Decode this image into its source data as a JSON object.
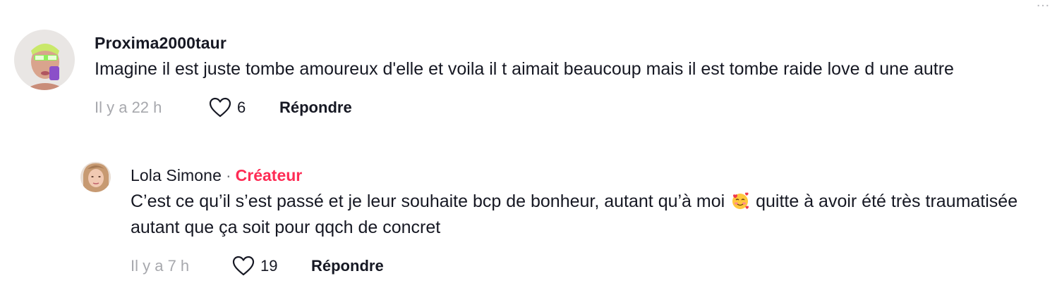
{
  "comments": [
    {
      "username": "Proxima2000taur",
      "text": "Imagine il est juste tombe amoureux d'elle et voila il t aimait beaucoup mais il est tombe raide love d une autre",
      "time": "Il y a 22 h",
      "likes": "6",
      "reply_label": "Répondre"
    },
    {
      "username": "Lola Simone",
      "separator": "·",
      "badge": "Créateur",
      "text_before_emoji": "C’est ce qu’il s’est passé et je leur souhaite bcp de bonheur, autant qu’à moi",
      "emoji": "smiling-face-with-hearts",
      "text_after_emoji": "quitte à avoir été très traumatisée autant que ça soit pour qqch de concret",
      "time": "Il y a 7 h",
      "likes": "19",
      "reply_label": "Répondre"
    }
  ],
  "colors": {
    "text": "#161823",
    "muted": "#a7a8ad",
    "creator_badge": "#fe2c55",
    "heart_outline": "#161823"
  }
}
